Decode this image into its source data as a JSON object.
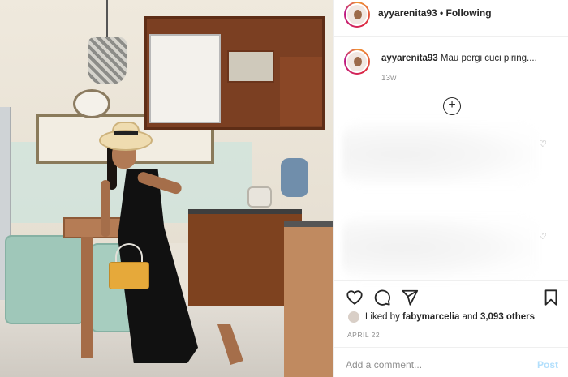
{
  "post": {
    "username": "ayyarenita93",
    "follow_status": "Following",
    "caption_user": "ayyarenita93",
    "caption_text": "Mau pergi cuci piring....",
    "caption_age": "13w",
    "likes_prefix": "Liked by ",
    "likes_user": "fabymarcelia",
    "likes_mid": " and ",
    "likes_count": "3,093 others",
    "date": "APRIL 22",
    "comment_placeholder": "Add a comment...",
    "post_label": "Post"
  },
  "icons": {
    "more": "more-options-icon",
    "plus": "load-more-comments-icon",
    "heart": "heart-icon",
    "comment": "comment-icon",
    "share": "share-icon",
    "save": "save-icon"
  },
  "colors": {
    "post_button": "#b2dffc",
    "muted": "#8e8e8e",
    "text": "#262626"
  }
}
